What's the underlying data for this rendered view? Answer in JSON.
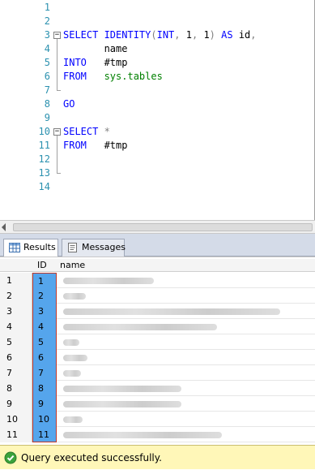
{
  "editor": {
    "lines": [
      {
        "n": "1",
        "segments": []
      },
      {
        "n": "2",
        "segments": []
      },
      {
        "n": "3",
        "segments": [
          {
            "t": "SELECT ",
            "c": "kw"
          },
          {
            "t": "IDENTITY",
            "c": "kw"
          },
          {
            "t": "(",
            "c": "gray"
          },
          {
            "t": "INT",
            "c": "kw"
          },
          {
            "t": ", ",
            "c": "gray"
          },
          {
            "t": "1",
            "c": "num"
          },
          {
            "t": ", ",
            "c": "gray"
          },
          {
            "t": "1",
            "c": "num"
          },
          {
            "t": ") ",
            "c": "gray"
          },
          {
            "t": "AS ",
            "c": "kw"
          },
          {
            "t": "id",
            "c": ""
          },
          {
            "t": ",",
            "c": "gray"
          }
        ]
      },
      {
        "n": "4",
        "segments": [
          {
            "t": "       name",
            "c": ""
          }
        ]
      },
      {
        "n": "5",
        "segments": [
          {
            "t": "INTO   ",
            "c": "kw"
          },
          {
            "t": "#tmp",
            "c": ""
          }
        ]
      },
      {
        "n": "6",
        "segments": [
          {
            "t": "FROM   ",
            "c": "kw"
          },
          {
            "t": "sys.tables",
            "c": "obj"
          }
        ]
      },
      {
        "n": "7",
        "segments": []
      },
      {
        "n": "8",
        "segments": [
          {
            "t": "GO",
            "c": "kw"
          }
        ]
      },
      {
        "n": "9",
        "segments": []
      },
      {
        "n": "10",
        "segments": [
          {
            "t": "SELECT ",
            "c": "kw"
          },
          {
            "t": "*",
            "c": "gray"
          }
        ]
      },
      {
        "n": "11",
        "segments": [
          {
            "t": "FROM   ",
            "c": "kw"
          },
          {
            "t": "#tmp",
            "c": ""
          }
        ]
      },
      {
        "n": "12",
        "segments": []
      },
      {
        "n": "13",
        "segments": []
      },
      {
        "n": "14",
        "segments": []
      }
    ],
    "collapse_glyph": "−"
  },
  "tabs": [
    {
      "label": "Results",
      "active": true,
      "icon": "grid-icon"
    },
    {
      "label": "Messages",
      "active": false,
      "icon": "messages-icon"
    }
  ],
  "grid": {
    "columns": [
      "ID",
      "name"
    ],
    "rows": [
      {
        "rownum": "1",
        "id": "1"
      },
      {
        "rownum": "2",
        "id": "2"
      },
      {
        "rownum": "3",
        "id": "3"
      },
      {
        "rownum": "4",
        "id": "4"
      },
      {
        "rownum": "5",
        "id": "5"
      },
      {
        "rownum": "6",
        "id": "6"
      },
      {
        "rownum": "7",
        "id": "7"
      },
      {
        "rownum": "8",
        "id": "8"
      },
      {
        "rownum": "9",
        "id": "9"
      },
      {
        "rownum": "10",
        "id": "10"
      },
      {
        "rownum": "11",
        "id": "11"
      }
    ],
    "selection_color": "#55a5ec",
    "selection_border": "#c0392b"
  },
  "status": {
    "message": "Query executed successfully.",
    "icon": "check-circle-icon",
    "background": "#fff7b8"
  }
}
